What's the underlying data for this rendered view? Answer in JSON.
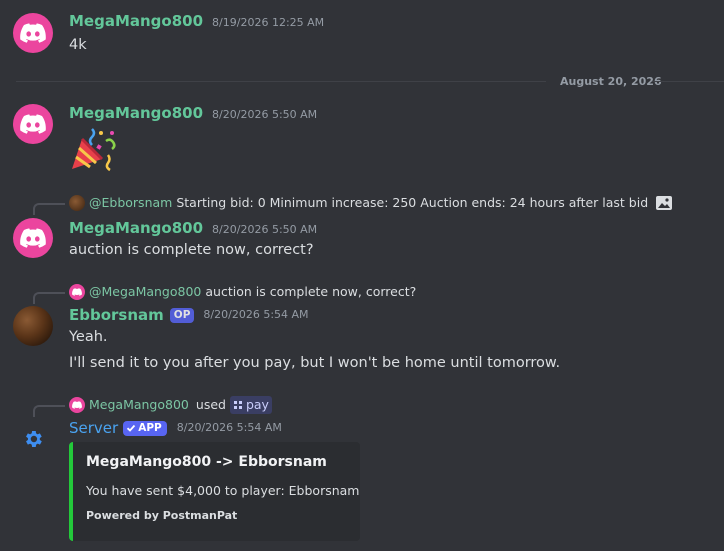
{
  "messages": [
    {
      "author": "MegaMango800",
      "timestamp": "8/19/2026 12:25 AM",
      "content": "4k"
    },
    {
      "author": "MegaMango800",
      "timestamp": "8/20/2026 5:50 AM",
      "content_emoji": "🎉"
    },
    {
      "author": "MegaMango800",
      "timestamp": "8/20/2026 5:50 AM",
      "content": "auction is complete now, correct?",
      "reply_to": {
        "author": "@Ebborsnam",
        "text": "Starting bid: 0 Minimum increase: 250 Auction ends: 24 hours after last bid"
      }
    },
    {
      "author": "Ebborsnam",
      "badge": "OP",
      "timestamp": "8/20/2026 5:54 AM",
      "lines": [
        "Yeah.",
        "I'll send it to you after you pay, but I won't be home until tomorrow."
      ],
      "reply_to": {
        "author": "@MegaMango800",
        "text": "auction is complete now, correct?"
      }
    },
    {
      "author": "Server",
      "badge": "APP",
      "timestamp": "8/20/2026 5:54 AM",
      "interaction": {
        "user": "MegaMango800",
        "used_label": "used",
        "command": "pay"
      },
      "embed": {
        "title": "MegaMango800 -> Ebborsnam",
        "description": "You have sent $4,000 to player: Ebborsnam",
        "footer": "Powered by PostmanPat",
        "color": "#23c93a"
      }
    }
  ],
  "date_divider": "August 20, 2026",
  "colors": {
    "background": "#313338",
    "username_green": "#63c79a",
    "app_blue": "#4aa3f0",
    "blurple": "#5865f2"
  }
}
